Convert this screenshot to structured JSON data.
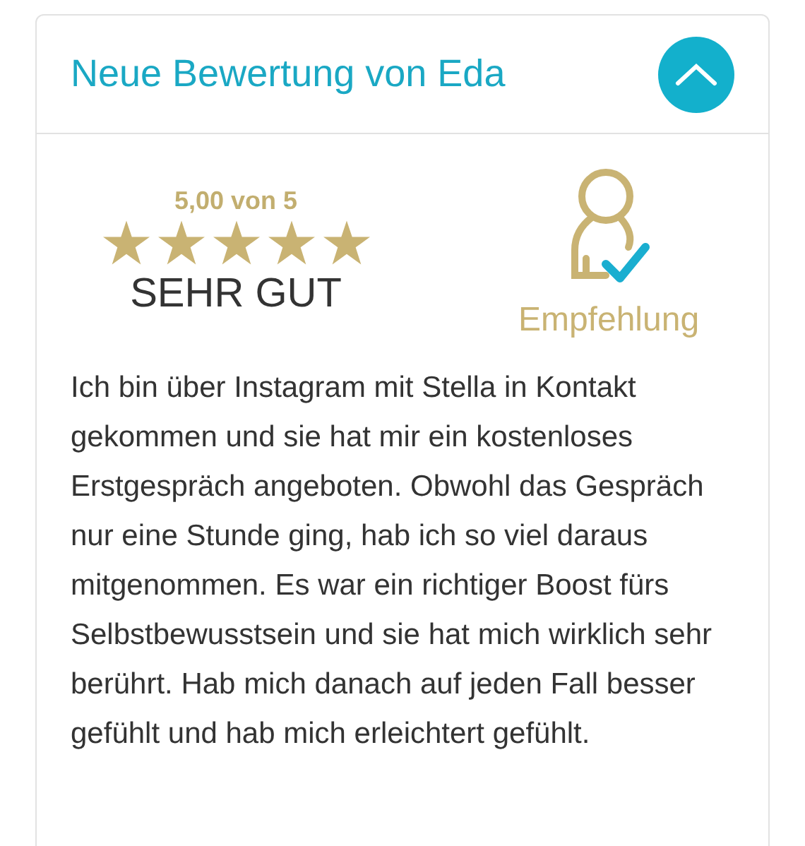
{
  "card": {
    "title": "Neue Bewertung von Eda",
    "expanded": true
  },
  "rating": {
    "score": "5,00 von 5",
    "stars": 5,
    "verdict": "SEHR GUT"
  },
  "recommendation": {
    "label": "Empfehlung"
  },
  "review": "Ich bin über Instagram mit Stella in Kontakt gekommen und sie hat mir ein kostenloses Erstgespräch angeboten. Obwohl das Gespräch nur eine Stunde ging, hab ich so viel daraus mitgenommen. Es war ein richtiger Boost fürs Selbstbewusstsein und sie hat mich wirklich sehr berührt. Hab mich danach auf jeden Fall besser gefühlt und hab mich erleichtert gefühlt."
}
